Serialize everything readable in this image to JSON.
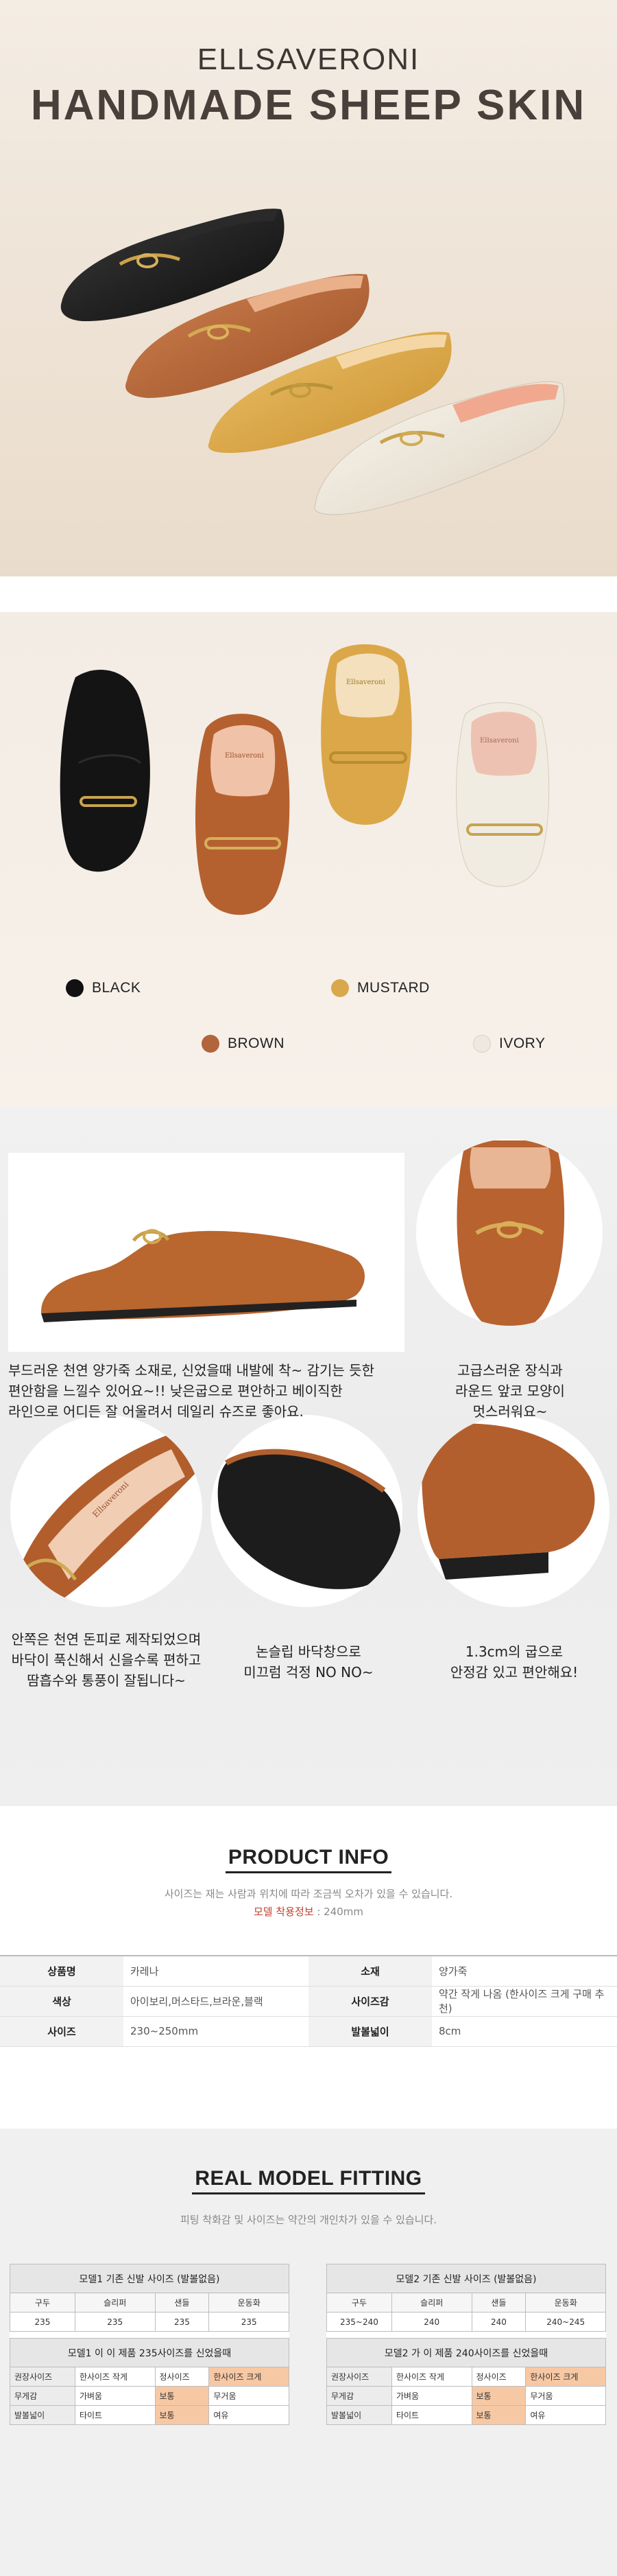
{
  "hero": {
    "brand": "ELLSAVERONI",
    "headline": "HANDMADE SHEEP SKIN"
  },
  "colors": {
    "options": [
      {
        "name": "BLACK",
        "hex": "#111111"
      },
      {
        "name": "MUSTARD",
        "hex": "#d9a84c"
      },
      {
        "name": "BROWN",
        "hex": "#b2643a"
      },
      {
        "name": "IVORY",
        "hex": "#eee9df"
      }
    ]
  },
  "details": {
    "caption1": "부드러운 천연 양가죽 소재로, 신었을때 내발에 착~ 감기는 듯한\n편안함을 느낄수 있어요~!! 낮은굽으로 편안하고 베이직한\n라인으로 어디든 잘 어울려서 데일리 슈즈로 좋아요.",
    "caption2": "고급스러운 장식과\n라운드 앞코 모양이\n멋스러워요~",
    "caption3": "안쪽은 천연 돈피로 제작되었으며\n바닥이 푹신해서 신을수록 편하고\n땀흡수와 통풍이 잘됩니다~",
    "caption4": "논슬립 바닥창으로\n미끄럼 걱정 NO NO~",
    "caption5": "1.3cm의 굽으로\n안정감 있고 편안해요!",
    "insole_logo": "Ellsaveroni"
  },
  "product_info": {
    "title": "PRODUCT INFO",
    "note": "사이즈는 재는 사람과 위치에 따라 조금씩 오차가 있을 수 있습니다.",
    "model_label": "모델 착용정보",
    "model_value": " : 240mm",
    "rows": [
      {
        "k1": "상품명",
        "v1": "카레나",
        "k2": "소재",
        "v2": "양가죽"
      },
      {
        "k1": "색상",
        "v1": "아이보리,머스타드,브라운,블랙",
        "k2": "사이즈감",
        "v2": "약간 작게 나옴 (한사이즈 크게 구매 추천)"
      },
      {
        "k1": "사이즈",
        "v1": "230~250mm",
        "k2": "발볼넓이",
        "v2": "8cm"
      }
    ]
  },
  "fitting": {
    "title": "REAL MODEL FITTING",
    "note": "피팅 착화감 및 사이즈는 약간의 개인차가 있을 수 있습니다.",
    "headers": [
      "구두",
      "슬리퍼",
      "샌들",
      "운동화"
    ],
    "rows_labels": [
      "권장사이즈",
      "무게감",
      "발볼넓이"
    ],
    "model1": {
      "title": "모델1 기존 신발 사이즈 (발볼없음)",
      "sizes": [
        "235",
        "235",
        "235",
        "235"
      ],
      "fit_title": "모델1 이 이 제품 235사이즈를 신었을때",
      "size_opts": [
        "한사이즈 작게",
        "정사이즈",
        "한사이즈 크게"
      ],
      "weight_opts": [
        "가벼움",
        "보통",
        "무거움"
      ],
      "width_opts": [
        "타이트",
        "보통",
        "여유"
      ]
    },
    "model2": {
      "title": "모델2 기존 신발 사이즈 (발볼없음)",
      "sizes": [
        "235~240",
        "240",
        "240",
        "240~245"
      ],
      "fit_title": "모델2 가 이 제품 240사이즈를 신었을때",
      "size_opts": [
        "한사이즈 작게",
        "정사이즈",
        "한사이즈 크게"
      ],
      "weight_opts": [
        "가벼움",
        "보통",
        "무거움"
      ],
      "width_opts": [
        "타이트",
        "보통",
        "여유"
      ]
    }
  }
}
